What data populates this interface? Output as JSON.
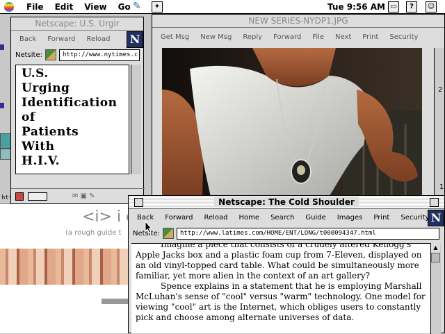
{
  "menubar": {
    "items": [
      "File",
      "Edit",
      "View",
      "Go"
    ],
    "clock": "Tue 9:56 AM",
    "icon_names": [
      "apple-icon",
      "netscape-app-icon",
      "puzzle-icon",
      "help-icon",
      "finder-icon"
    ]
  },
  "nyt_window": {
    "title": "Netscape: U.S. Urgir",
    "toolbar": [
      "Back",
      "Forward",
      "Reload"
    ],
    "location_label": "Netsite:",
    "url": "http://www.nytimes.c",
    "headline": [
      "U.S.",
      "Urging",
      "Identification",
      "of",
      "Patients",
      "With",
      "H.I.V."
    ]
  },
  "image_window": {
    "title": "NEW SERIES-NYDP1.JPG",
    "toolbar": [
      "Get Msg",
      "New Msg",
      "Reply",
      "Forward",
      "File",
      "Next",
      "Print",
      "Security"
    ]
  },
  "cold_window": {
    "title": "Netscape: The Cold Shoulder",
    "toolbar": [
      "Back",
      "Forward",
      "Reload",
      "Home",
      "Search",
      "Guide",
      "Images",
      "Print",
      "Security"
    ],
    "location_label": "Netsite:",
    "url": "http://www.latimes.com/HOME/ENT/LONG/t000094347.html",
    "paragraphs": [
      "Imagine a piece that consists of a crudely altered Kellogg's Apple Jacks box and a plastic foam cup from 7-Eleven, displayed on an old vinyl-topped card table. What could be simultaneously more familiar, yet more alien in the context of an art gallery?",
      "Spence explains in a statement that he is employing Marshall McLuhan's sense of \"cool\" versus \"warm\" technology. One model for viewing \"cool\" art is the Internet, which obliges users to constantly pick and choose among alternate universes of data."
    ]
  },
  "background_page": {
    "logo_text": "<i> i c",
    "subtitle": "(a rough guide t",
    "url_fragment": "http"
  },
  "right_edge": {
    "digit_1": "2",
    "digit_2": "1"
  },
  "colors": {
    "netscape_logo": "#203060",
    "title_stripe": "#ffffff",
    "window_gray": "#dddddd"
  }
}
